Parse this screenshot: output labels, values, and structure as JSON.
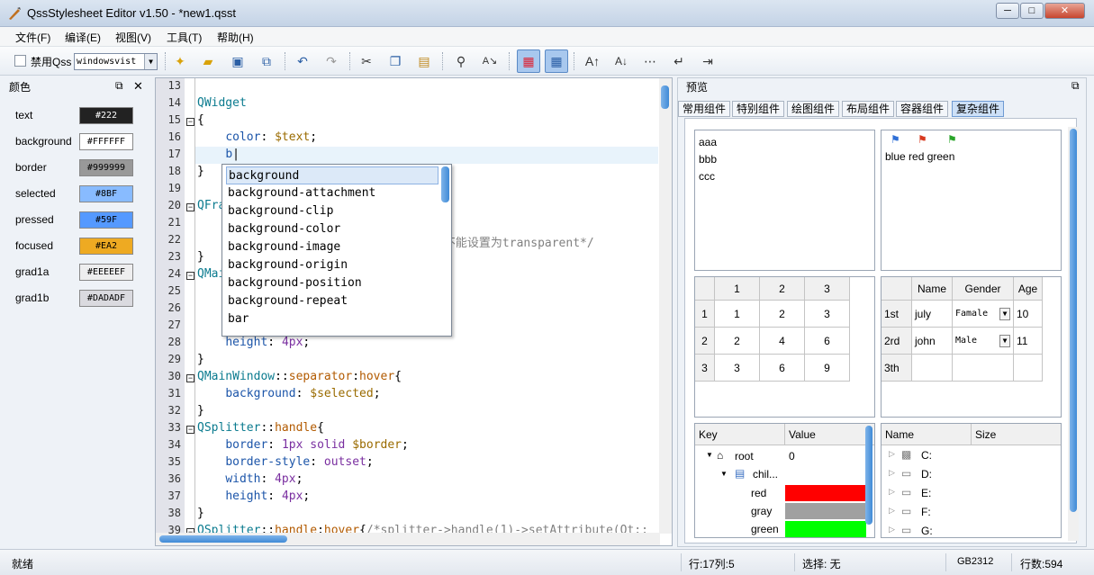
{
  "window": {
    "title": "QssStylesheet Editor v1.50 - *new1.qsst",
    "min": "─",
    "max": "□",
    "close": "✕"
  },
  "menu": [
    "文件(F)",
    "编译(E)",
    "视图(V)",
    "工具(T)",
    "帮助(H)"
  ],
  "toolbar": {
    "disable_label": "禁用Qss",
    "style_value": "windowsvist"
  },
  "colors_panel": {
    "title": "颜色",
    "items": [
      {
        "name": "text",
        "value": "#222",
        "bg": "#222222",
        "fg": "#ffffff"
      },
      {
        "name": "background",
        "value": "#FFFFFF",
        "bg": "#ffffff",
        "fg": "#000000"
      },
      {
        "name": "border",
        "value": "#999999",
        "bg": "#999999",
        "fg": "#000000"
      },
      {
        "name": "selected",
        "value": "#8BF",
        "bg": "#88bbff",
        "fg": "#000000"
      },
      {
        "name": "pressed",
        "value": "#59F",
        "bg": "#5599ff",
        "fg": "#000000"
      },
      {
        "name": "focused",
        "value": "#EA2",
        "bg": "#eeaa22",
        "fg": "#000000"
      },
      {
        "name": "grad1a",
        "value": "#EEEEEF",
        "bg": "#eeeeef",
        "fg": "#000000"
      },
      {
        "name": "grad1b",
        "value": "#DADADF",
        "bg": "#dadadf",
        "fg": "#000000"
      }
    ]
  },
  "editor": {
    "line_numbers": [
      "13",
      "14",
      "15",
      "16",
      "17",
      "18",
      "19",
      "20",
      "21",
      "22",
      "23",
      "24",
      "25",
      "26",
      "27",
      "28",
      "29",
      "30",
      "31",
      "32",
      "33",
      "34",
      "35",
      "36",
      "37",
      "38",
      "39"
    ]
  },
  "autocomplete": [
    "background",
    "background-attachment",
    "background-clip",
    "background-color",
    "background-image",
    "background-origin",
    "background-position",
    "background-repeat",
    "bar"
  ],
  "preview": {
    "title": "预览",
    "tabs": [
      "常用组件",
      "特别组件",
      "绘图组件",
      "布局组件",
      "容器组件",
      "复杂组件"
    ],
    "list1": [
      "aaa",
      "bbb",
      "ccc"
    ],
    "list2": "blue red green",
    "grid1": {
      "headers": [
        "1",
        "2",
        "3"
      ],
      "rows": [
        [
          "1",
          "1",
          "2",
          "3"
        ],
        [
          "2",
          "2",
          "4",
          "6"
        ],
        [
          "3",
          "3",
          "6",
          "9"
        ]
      ]
    },
    "grid2": {
      "headers": [
        "Name",
        "Gender",
        "Age"
      ],
      "rows": [
        [
          "1st",
          "july",
          "Famale",
          "10"
        ],
        [
          "2rd",
          "john",
          "Male",
          "11"
        ],
        [
          "3th",
          "",
          "",
          ""
        ]
      ]
    },
    "tree1": {
      "headers": [
        "Key",
        "Value"
      ],
      "root": "root",
      "root_value": "0",
      "child": "chil...",
      "items": [
        {
          "label": "red",
          "color": "#ff0000"
        },
        {
          "label": "gray",
          "color": "#a0a0a0"
        },
        {
          "label": "green",
          "color": "#00ff00"
        }
      ]
    },
    "tree2": {
      "headers": [
        "Name",
        "Size"
      ],
      "drives": [
        "C:",
        "D:",
        "E:",
        "F:",
        "G:"
      ]
    }
  },
  "status": {
    "ready": "就绪",
    "position": "行:17列:5",
    "selection": "选择: 无",
    "encoding": "GB2312",
    "lines": "行数:594"
  }
}
